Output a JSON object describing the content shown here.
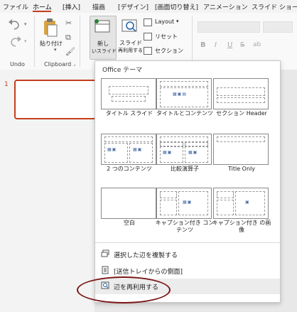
{
  "tabs": [
    "ファイル",
    "ホーム",
    "[挿入]",
    "描画",
    "[デザイン]",
    "[画面切り替え]",
    "アニメーション",
    "スライド ショー"
  ],
  "ribbon": {
    "undo_label": "Undo",
    "clipboard_label": "Clipboard",
    "paste_label": "貼り付け",
    "new_slide_label": "新し",
    "new_slide_label2": "いスライド",
    "reuse_label": "スライド",
    "reuse_label2": "再利用する",
    "layout_label": "Layout",
    "reset_label": "リセット",
    "section_label": "セクション",
    "font_buttons": [
      "B",
      "I",
      "U",
      "S",
      "ab"
    ]
  },
  "slides": {
    "number": "1"
  },
  "gallery": {
    "title": "Office テーマ",
    "layouts": [
      {
        "label": "タイトル スライド"
      },
      {
        "label": "タイトルとコンテンツ"
      },
      {
        "label": "セクション Header"
      },
      {
        "label": "2 つのコンテンツ"
      },
      {
        "label": "比較演算子"
      },
      {
        "label": "Title Only"
      },
      {
        "label": "空白"
      },
      {
        "label": "キャプション付き コンテンツ"
      },
      {
        "label": "キャプション付き の画像"
      }
    ],
    "menu": [
      {
        "label": "選択した辺を複製する"
      },
      {
        "label": "[送信トレイからの側面]"
      },
      {
        "label": "辺を再利用する"
      }
    ]
  }
}
